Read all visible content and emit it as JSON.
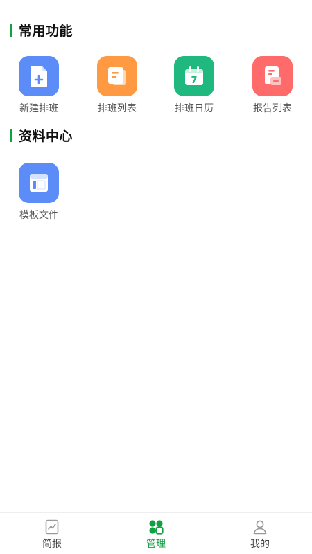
{
  "sections": [
    {
      "title": "常用功能",
      "items": [
        {
          "label": "新建排班",
          "icon": "new-document-icon",
          "color": "#5b8cf7"
        },
        {
          "label": "排班列表",
          "icon": "list-document-icon",
          "color": "#ff9a42"
        },
        {
          "label": "排班日历",
          "icon": "calendar-icon",
          "color": "#1fb87e"
        },
        {
          "label": "报告列表",
          "icon": "report-list-icon",
          "color": "#ff6b6b"
        }
      ]
    },
    {
      "title": "资料中心",
      "items": [
        {
          "label": "模板文件",
          "icon": "template-layout-icon",
          "color": "#5b8cf7"
        }
      ]
    }
  ],
  "calendar_day": "7",
  "tabbar": {
    "active_color": "#11a043",
    "items": [
      {
        "label": "简报",
        "icon": "briefing-chart-icon",
        "active": false
      },
      {
        "label": "管理",
        "icon": "manage-grid-icon",
        "active": true
      },
      {
        "label": "我的",
        "icon": "user-profile-icon",
        "active": false
      }
    ]
  }
}
